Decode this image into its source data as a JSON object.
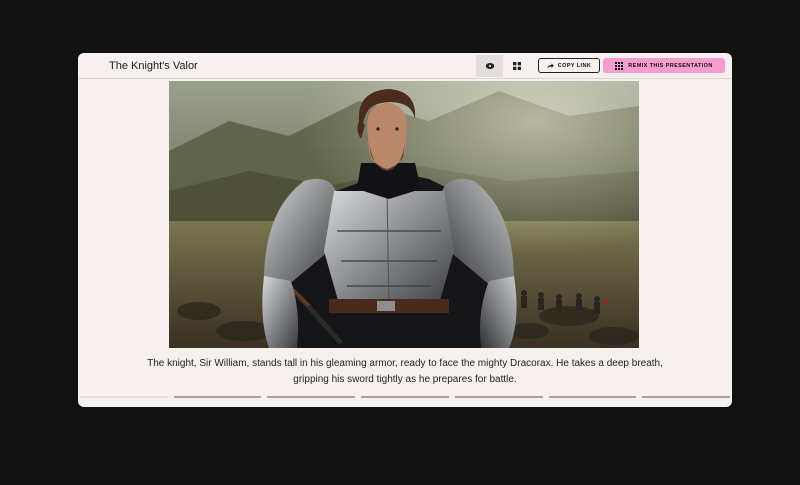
{
  "presentation": {
    "title": "The Knight's Valor"
  },
  "toolbar": {
    "copy_link_label": "COPY LINK",
    "remix_label": "REMIX THIS PRESENTATION",
    "copy_icon": "share-arrow-icon",
    "remix_icon": "grid-icon",
    "view_icons": [
      "eye-icon",
      "grid-view-icon"
    ],
    "active_view": "eye"
  },
  "slide": {
    "image_subject": "knight-in-armor-photo",
    "caption": "The knight, Sir William, stands tall in his gleaming armor, ready to face the mighty Dracorax. He takes a deep breath, gripping his sword tightly as he prepares for battle."
  },
  "progress": {
    "total_slides": 7,
    "current_slide": 1
  },
  "colors": {
    "accent_pink": "#f79ccf",
    "background": "#111111",
    "window": "#f6f1ee"
  }
}
